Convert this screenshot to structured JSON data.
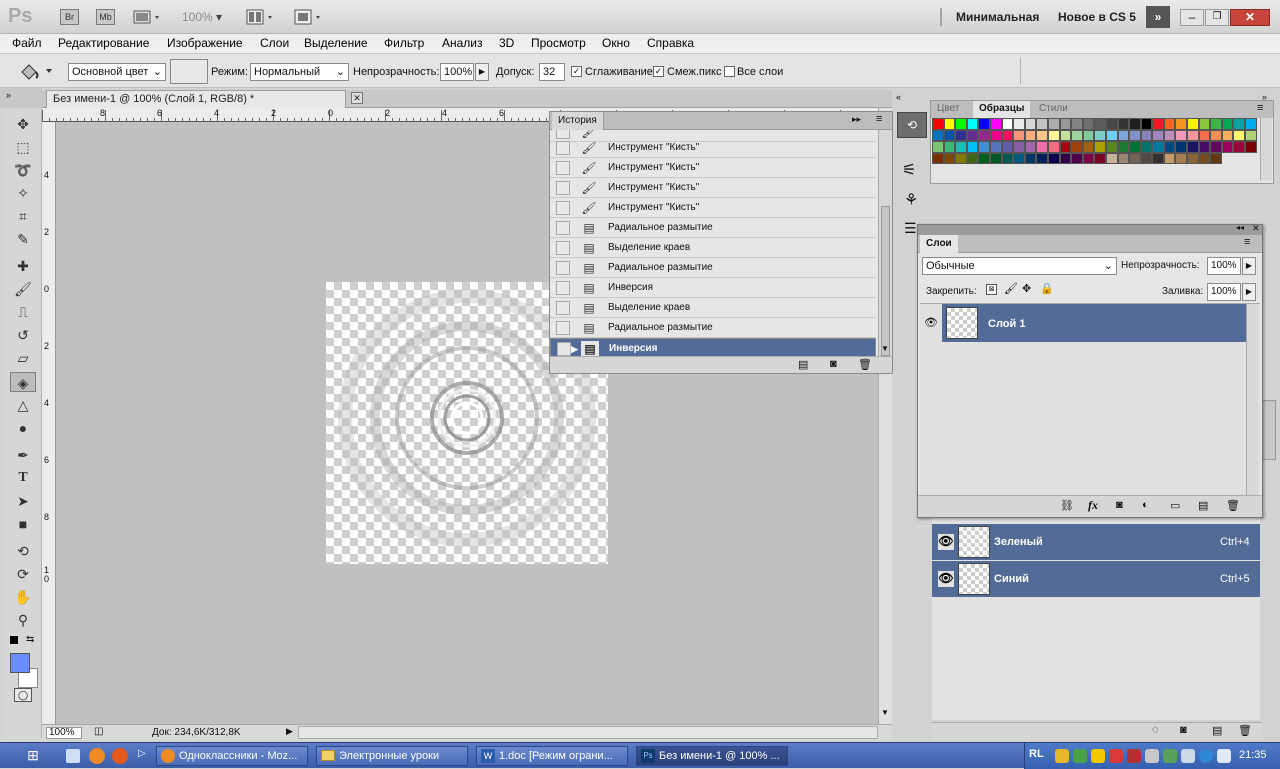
{
  "app": {
    "logo": "Ps",
    "bridge": "Br",
    "minibridge": "Mb",
    "zoom": "100%",
    "workspace_minimal": "Минимальная",
    "workspace_new": "Новое в CS 5"
  },
  "menu": [
    "Файл",
    "Редактирование",
    "Изображение",
    "Слои",
    "Выделение",
    "Фильтр",
    "Анализ",
    "3D",
    "Просмотр",
    "Окно",
    "Справка"
  ],
  "options": {
    "fill_source": "Основной цвет",
    "mode_label": "Режим:",
    "mode_value": "Нормальный",
    "opacity_label": "Непрозрачность:",
    "opacity_value": "100%",
    "tolerance_label": "Допуск:",
    "tolerance_value": "32",
    "antialias_label": "Сглаживание",
    "contiguous_label": "Смеж.пикс",
    "all_layers_label": "Все слои"
  },
  "document": {
    "tab_title": "Без имени-1 @ 100% (Слой 1, RGB/8) *",
    "zoom": "100%",
    "doc_info": "Док: 234,6K/312,8K"
  },
  "ruler": {
    "top": [
      "8",
      "6",
      "4",
      "2",
      "0",
      "2",
      "4",
      "6"
    ],
    "left": [
      "4",
      "2",
      "0",
      "2",
      "4",
      "6",
      "8",
      "1\n0"
    ]
  },
  "history": {
    "title": "История",
    "items": [
      {
        "label": "Инструмент \"Кисть\"",
        "icon": "brush"
      },
      {
        "label": "Инструмент \"Кисть\"",
        "icon": "brush"
      },
      {
        "label": "Инструмент \"Кисть\"",
        "icon": "brush"
      },
      {
        "label": "Инструмент \"Кисть\"",
        "icon": "brush"
      },
      {
        "label": "Радиальное размытие",
        "icon": "filter"
      },
      {
        "label": "Выделение краев",
        "icon": "filter"
      },
      {
        "label": "Радиальное размытие",
        "icon": "filter"
      },
      {
        "label": "Инверсия",
        "icon": "filter"
      },
      {
        "label": "Выделение краев",
        "icon": "filter"
      },
      {
        "label": "Радиальное размытие",
        "icon": "filter"
      },
      {
        "label": "Инверсия",
        "icon": "filter"
      }
    ]
  },
  "color_panel": {
    "tabs": [
      "Цвет",
      "Образцы",
      "Стили"
    ],
    "swatch_colors": [
      "#ff0000",
      "#ffff00",
      "#00ff00",
      "#00ffff",
      "#0000ff",
      "#ff00ff",
      "#ffffff",
      "#ebebeb",
      "#d6d6d6",
      "#c2c2c2",
      "#adadad",
      "#999999",
      "#858585",
      "#707070",
      "#5c5c5c",
      "#474747",
      "#333333",
      "#1f1f1f",
      "#000000",
      "#ed1c24",
      "#f26522",
      "#f7941d",
      "#fff200",
      "#8dc63f",
      "#39b54a",
      "#00a651",
      "#00a99d",
      "#00aeef",
      "#0072bc",
      "#0054a6",
      "#2e3192",
      "#662d91",
      "#92278f",
      "#ec008c",
      "#ed145b",
      "#f69679",
      "#f9ad81",
      "#fdc689",
      "#fff799",
      "#c4df9b",
      "#a3d39c",
      "#82ca9c",
      "#7accc8",
      "#6dcff6",
      "#7da7d9",
      "#8393ca",
      "#8781bd",
      "#a186be",
      "#bd8cbf",
      "#f49ac1",
      "#f5989d",
      "#f26c4f",
      "#f68e56",
      "#fbaf5d",
      "#fff568",
      "#acd373",
      "#7cc576",
      "#3cb878",
      "#1cbbb4",
      "#00bff3",
      "#448ccb",
      "#5574b9",
      "#605ca8",
      "#855fa8",
      "#a763a8",
      "#f06eaa",
      "#f26d7d",
      "#9e0b0f",
      "#a0410d",
      "#a36209",
      "#aba000",
      "#598527",
      "#1a7b30",
      "#007236",
      "#00746b",
      "#0076a3",
      "#004a80",
      "#003471",
      "#1b1464",
      "#440e62",
      "#630460",
      "#9e005d",
      "#9e0039",
      "#790000",
      "#7b2e00",
      "#7d4900",
      "#827b00",
      "#406618",
      "#005e20",
      "#005826",
      "#005952",
      "#005b7f",
      "#003663",
      "#002157",
      "#0d004c",
      "#32004b",
      "#4b0049",
      "#7b0046",
      "#7a0026",
      "#c7b299",
      "#998675",
      "#736357",
      "#534741",
      "#37302d",
      "#c69c6d",
      "#a67c52",
      "#8c6239",
      "#754c24",
      "#603913"
    ]
  },
  "layers": {
    "title": "Слои",
    "blend_mode": "Обычные",
    "opacity_label": "Непрозрачность:",
    "opacity_value": "100%",
    "lock_label": "Закрепить:",
    "fill_label": "Заливка:",
    "fill_value": "100%",
    "layer_name": "Слой 1"
  },
  "channels": {
    "items": [
      {
        "name": "Зеленый",
        "shortcut": "Ctrl+4"
      },
      {
        "name": "Синий",
        "shortcut": "Ctrl+5"
      }
    ]
  },
  "taskbar": {
    "tasks": [
      "Одноклассники - Moz...",
      "Электронные уроки",
      "1.doc [Режим ограни...",
      "Без имени-1 @ 100% ..."
    ],
    "lang": "RL",
    "time": "21:35"
  }
}
